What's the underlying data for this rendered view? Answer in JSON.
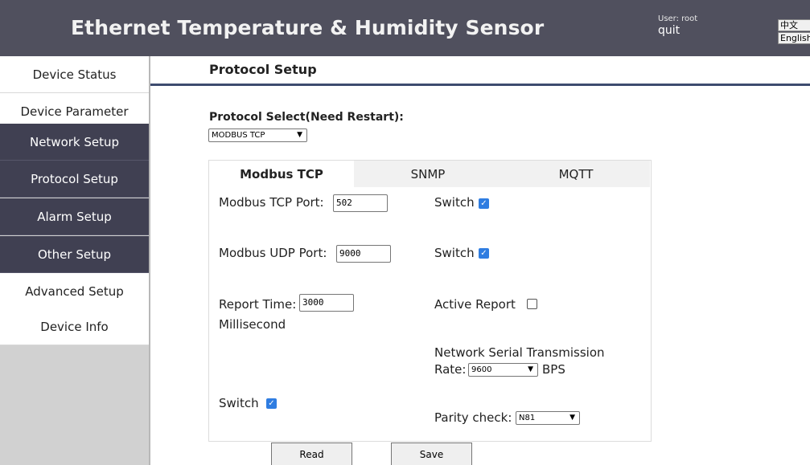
{
  "header": {
    "title": "Ethernet Temperature & Humidity Sensor",
    "user": "User: root",
    "quit": "quit",
    "lang_zh": "中文",
    "lang_en": "English"
  },
  "sidebar": {
    "items": [
      {
        "label": "Device Status"
      },
      {
        "label": "Device Parameter"
      },
      {
        "label": "Network Setup"
      },
      {
        "label": "Protocol Setup"
      },
      {
        "label": "Alarm Setup"
      },
      {
        "label": "Other Setup"
      },
      {
        "label": "Advanced Setup"
      },
      {
        "label": "Device Info"
      }
    ]
  },
  "main": {
    "title": "Protocol Setup",
    "protocol_select_label": "Protocol Select(Need Restart):",
    "protocol_select_value": "MODBUS TCP",
    "tabs": [
      {
        "label": "Modbus TCP",
        "active": true
      },
      {
        "label": "SNMP",
        "active": false
      },
      {
        "label": "MQTT",
        "active": false
      }
    ],
    "modbus": {
      "tcp_port_label": "Modbus TCP Port:",
      "tcp_port_value": "502",
      "tcp_switch_label": "Switch",
      "tcp_switch_checked": true,
      "udp_port_label": "Modbus UDP Port:",
      "udp_port_value": "9000",
      "udp_switch_label": "Switch",
      "udp_switch_checked": true,
      "report_time_label": "Report Time:",
      "report_time_value": "3000",
      "report_time_unit": "Millisecond",
      "active_report_label": "Active Report",
      "active_report_checked": false,
      "serial_rate_label_line1": "Network Serial Transmission",
      "serial_rate_label_line2": "Rate:",
      "serial_rate_value": "9600",
      "serial_rate_unit": "BPS",
      "switch_label": "Switch",
      "switch_checked": true,
      "parity_label": "Parity check:",
      "parity_value": "N81"
    },
    "buttons": {
      "read": "Read",
      "save": "Save"
    }
  },
  "colors": {
    "header_bg": "#50505e",
    "sidebar_dark": "#404052",
    "title_rule": "#3d4b6f",
    "checkbox_accent": "#2f7de1"
  }
}
